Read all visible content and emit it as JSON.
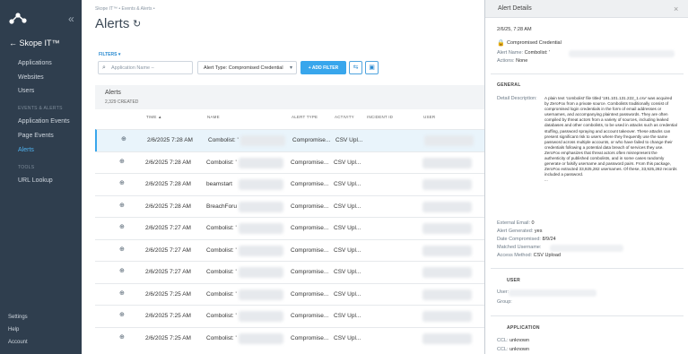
{
  "sidebar": {
    "brand": "Skope IT™",
    "collapse_icon": "«",
    "items": [
      {
        "label": "Applications"
      },
      {
        "label": "Websites"
      },
      {
        "label": "Users"
      }
    ],
    "section_events": "EVENTS & ALERTS",
    "event_items": [
      {
        "label": "Application Events"
      },
      {
        "label": "Page Events"
      },
      {
        "label": "Alerts"
      }
    ],
    "section_tools": "TOOLS",
    "tool_items": [
      {
        "label": "URL Lookup"
      }
    ],
    "footer": [
      {
        "label": "Settings"
      },
      {
        "label": "Help"
      },
      {
        "label": "Account"
      }
    ],
    "active_color": "#4fb3f0"
  },
  "main": {
    "breadcrumb": "Skope IT™ • Events & Alerts •",
    "title": "Alerts",
    "refresh_icon": "↻",
    "filters_label": "FILTERS ▾",
    "search_placeholder": "Application Name –",
    "alert_type_filter": "Alert Type: Compromised Credential",
    "add_filter": "+ ADD FILTER",
    "table": {
      "title": "Alerts",
      "count": "2,329 CREATED",
      "columns": [
        "TIME ▲",
        "NAME",
        "ALERT TYPE",
        "ACTIVITY",
        "INCIDENT ID",
        "USER"
      ],
      "rows": [
        {
          "time": "2/6/2025 7:28 AM",
          "name": "Combolist: '",
          "type": "Compromise...",
          "activity": "CSV Upl...",
          "selected": true
        },
        {
          "time": "2/6/2025 7:28 AM",
          "name": "Combolist: '",
          "type": "Compromise...",
          "activity": "CSV Upl...",
          "selected": false
        },
        {
          "time": "2/6/2025 7:28 AM",
          "name": "beamstart",
          "type": "Compromise...",
          "activity": "CSV Upl...",
          "selected": false
        },
        {
          "time": "2/6/2025 7:28 AM",
          "name": "BreachForu",
          "type": "Compromise...",
          "activity": "CSV Upl...",
          "selected": false
        },
        {
          "time": "2/6/2025 7:27 AM",
          "name": "Combolist: '",
          "type": "Compromise...",
          "activity": "CSV Upl...",
          "selected": false
        },
        {
          "time": "2/6/2025 7:27 AM",
          "name": "Combolist: '",
          "type": "Compromise...",
          "activity": "CSV Upl...",
          "selected": false
        },
        {
          "time": "2/6/2025 7:27 AM",
          "name": "Combolist: '",
          "type": "Compromise...",
          "activity": "CSV Upl...",
          "selected": false
        },
        {
          "time": "2/6/2025 7:25 AM",
          "name": "Combolist: '",
          "type": "Compromise...",
          "activity": "CSV Upl...",
          "selected": false
        },
        {
          "time": "2/6/2025 7:25 AM",
          "name": "Combolist: '",
          "type": "Compromise...",
          "activity": "CSV Upl...",
          "selected": false
        },
        {
          "time": "2/6/2025 7:25 AM",
          "name": "Combolist: '",
          "type": "Compromise...",
          "activity": "CSV Upl...",
          "selected": false
        }
      ]
    }
  },
  "panel": {
    "title": "Alert Details",
    "close_icon": "×",
    "timestamp": "2/6/25, 7:28 AM",
    "alert_type": "Compromised Credential",
    "alert_name_label": "Alert Name:",
    "alert_name_value": "Combolist: '",
    "actions_label": "Actions:",
    "actions_value": "None",
    "general_section": "GENERAL",
    "detail_label": "Detail Description:",
    "detail_text": "A plain text 'combolist' file titled '191.101.131.222_1.csv' was acquired by ZeroFox from a private source. Combolists traditionally consist of compromised login credentials in the form of email addresses or usernames, and accompanying plaintext passwords. They are often compiled by threat actors from a variety of sources, including leaked databases and other combolists, to be used in attacks such as credential stuffing, password spraying and account takeover. These attacks can present significant risk to users where they frequently use the same password across multiple accounts, or who have failed to change their credentials following a potential data breach of services they use. ZeroFox emphasizes that threat actors often misrepresent the authenticity of published combolists, and in some cases randomly generate or falsify username and password pairs. From this package, ZeroFox extracted 33,925,282 usernames. Of these, 33,925,282 records included a password.",
    "ellipsis": "...",
    "external_email_label": "External Email:",
    "external_email_value": "0",
    "alert_generated_label": "Alert Generated:",
    "alert_generated_value": "yes",
    "date_compromised_label": "Date Compromised:",
    "date_compromised_value": "8/9/24",
    "matched_username_label": "Matched Username:",
    "access_method_label": "Access Method:",
    "access_method_value": "CSV Upload",
    "user_section": "USER",
    "user_label": "User:",
    "group_label": "Group:",
    "application_section": "APPLICATION",
    "ccl_label": "CCL:",
    "ccl_value": "unknown",
    "ccl2_value": "unknown"
  }
}
